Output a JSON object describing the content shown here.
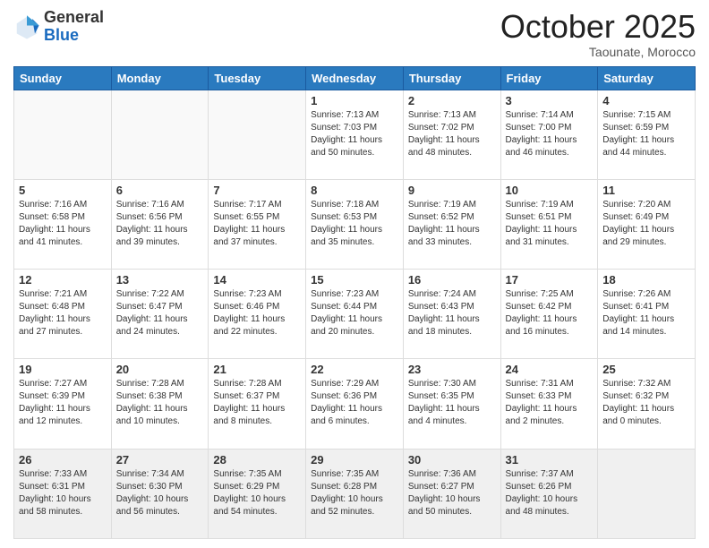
{
  "header": {
    "logo_general": "General",
    "logo_blue": "Blue",
    "month": "October 2025",
    "location": "Taounate, Morocco"
  },
  "days_of_week": [
    "Sunday",
    "Monday",
    "Tuesday",
    "Wednesday",
    "Thursday",
    "Friday",
    "Saturday"
  ],
  "weeks": [
    [
      {
        "day": "",
        "text": ""
      },
      {
        "day": "",
        "text": ""
      },
      {
        "day": "",
        "text": ""
      },
      {
        "day": "1",
        "text": "Sunrise: 7:13 AM\nSunset: 7:03 PM\nDaylight: 11 hours and 50 minutes."
      },
      {
        "day": "2",
        "text": "Sunrise: 7:13 AM\nSunset: 7:02 PM\nDaylight: 11 hours and 48 minutes."
      },
      {
        "day": "3",
        "text": "Sunrise: 7:14 AM\nSunset: 7:00 PM\nDaylight: 11 hours and 46 minutes."
      },
      {
        "day": "4",
        "text": "Sunrise: 7:15 AM\nSunset: 6:59 PM\nDaylight: 11 hours and 44 minutes."
      }
    ],
    [
      {
        "day": "5",
        "text": "Sunrise: 7:16 AM\nSunset: 6:58 PM\nDaylight: 11 hours and 41 minutes."
      },
      {
        "day": "6",
        "text": "Sunrise: 7:16 AM\nSunset: 6:56 PM\nDaylight: 11 hours and 39 minutes."
      },
      {
        "day": "7",
        "text": "Sunrise: 7:17 AM\nSunset: 6:55 PM\nDaylight: 11 hours and 37 minutes."
      },
      {
        "day": "8",
        "text": "Sunrise: 7:18 AM\nSunset: 6:53 PM\nDaylight: 11 hours and 35 minutes."
      },
      {
        "day": "9",
        "text": "Sunrise: 7:19 AM\nSunset: 6:52 PM\nDaylight: 11 hours and 33 minutes."
      },
      {
        "day": "10",
        "text": "Sunrise: 7:19 AM\nSunset: 6:51 PM\nDaylight: 11 hours and 31 minutes."
      },
      {
        "day": "11",
        "text": "Sunrise: 7:20 AM\nSunset: 6:49 PM\nDaylight: 11 hours and 29 minutes."
      }
    ],
    [
      {
        "day": "12",
        "text": "Sunrise: 7:21 AM\nSunset: 6:48 PM\nDaylight: 11 hours and 27 minutes."
      },
      {
        "day": "13",
        "text": "Sunrise: 7:22 AM\nSunset: 6:47 PM\nDaylight: 11 hours and 24 minutes."
      },
      {
        "day": "14",
        "text": "Sunrise: 7:23 AM\nSunset: 6:46 PM\nDaylight: 11 hours and 22 minutes."
      },
      {
        "day": "15",
        "text": "Sunrise: 7:23 AM\nSunset: 6:44 PM\nDaylight: 11 hours and 20 minutes."
      },
      {
        "day": "16",
        "text": "Sunrise: 7:24 AM\nSunset: 6:43 PM\nDaylight: 11 hours and 18 minutes."
      },
      {
        "day": "17",
        "text": "Sunrise: 7:25 AM\nSunset: 6:42 PM\nDaylight: 11 hours and 16 minutes."
      },
      {
        "day": "18",
        "text": "Sunrise: 7:26 AM\nSunset: 6:41 PM\nDaylight: 11 hours and 14 minutes."
      }
    ],
    [
      {
        "day": "19",
        "text": "Sunrise: 7:27 AM\nSunset: 6:39 PM\nDaylight: 11 hours and 12 minutes."
      },
      {
        "day": "20",
        "text": "Sunrise: 7:28 AM\nSunset: 6:38 PM\nDaylight: 11 hours and 10 minutes."
      },
      {
        "day": "21",
        "text": "Sunrise: 7:28 AM\nSunset: 6:37 PM\nDaylight: 11 hours and 8 minutes."
      },
      {
        "day": "22",
        "text": "Sunrise: 7:29 AM\nSunset: 6:36 PM\nDaylight: 11 hours and 6 minutes."
      },
      {
        "day": "23",
        "text": "Sunrise: 7:30 AM\nSunset: 6:35 PM\nDaylight: 11 hours and 4 minutes."
      },
      {
        "day": "24",
        "text": "Sunrise: 7:31 AM\nSunset: 6:33 PM\nDaylight: 11 hours and 2 minutes."
      },
      {
        "day": "25",
        "text": "Sunrise: 7:32 AM\nSunset: 6:32 PM\nDaylight: 11 hours and 0 minutes."
      }
    ],
    [
      {
        "day": "26",
        "text": "Sunrise: 7:33 AM\nSunset: 6:31 PM\nDaylight: 10 hours and 58 minutes."
      },
      {
        "day": "27",
        "text": "Sunrise: 7:34 AM\nSunset: 6:30 PM\nDaylight: 10 hours and 56 minutes."
      },
      {
        "day": "28",
        "text": "Sunrise: 7:35 AM\nSunset: 6:29 PM\nDaylight: 10 hours and 54 minutes."
      },
      {
        "day": "29",
        "text": "Sunrise: 7:35 AM\nSunset: 6:28 PM\nDaylight: 10 hours and 52 minutes."
      },
      {
        "day": "30",
        "text": "Sunrise: 7:36 AM\nSunset: 6:27 PM\nDaylight: 10 hours and 50 minutes."
      },
      {
        "day": "31",
        "text": "Sunrise: 7:37 AM\nSunset: 6:26 PM\nDaylight: 10 hours and 48 minutes."
      },
      {
        "day": "",
        "text": ""
      }
    ]
  ]
}
